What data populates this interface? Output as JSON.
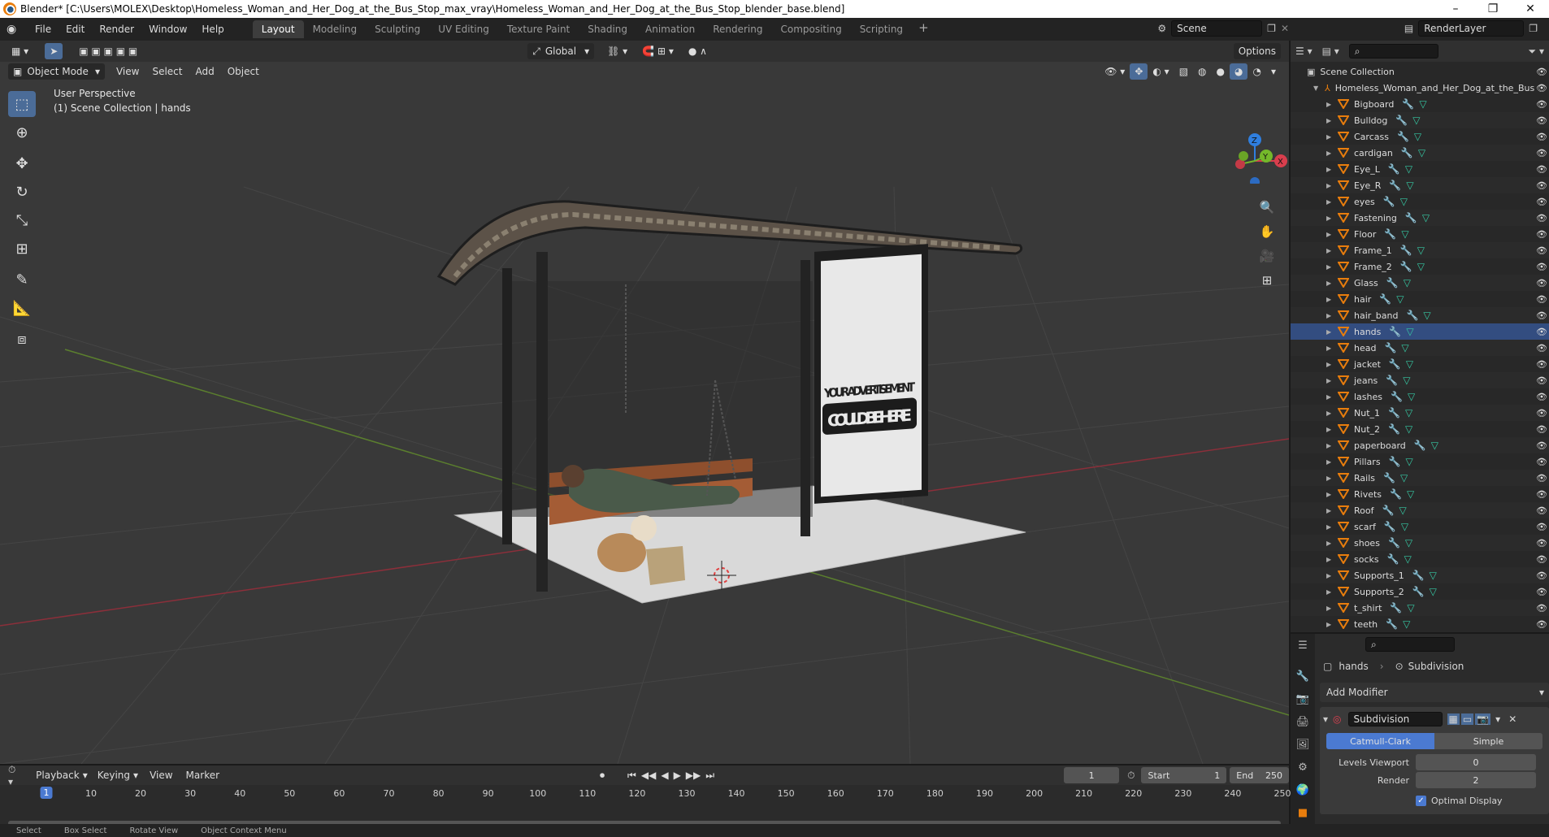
{
  "titlebar": {
    "title": "Blender* [C:\\Users\\MOLEX\\Desktop\\Homeless_Woman_and_Her_Dog_at_the_Bus_Stop_max_vray\\Homeless_Woman_and_Her_Dog_at_the_Bus_Stop_blender_base.blend]",
    "minimize": "–",
    "maximize": "❐",
    "close": "✕"
  },
  "menubar": {
    "items": [
      "File",
      "Edit",
      "Render",
      "Window",
      "Help"
    ],
    "workspaces": [
      "Layout",
      "Modeling",
      "Sculpting",
      "UV Editing",
      "Texture Paint",
      "Shading",
      "Animation",
      "Rendering",
      "Compositing",
      "Scripting"
    ],
    "active_workspace": "Layout",
    "add_tab": "+",
    "scene": "Scene",
    "render_layer": "RenderLayer"
  },
  "viewport": {
    "mode": "Object Mode",
    "menus": [
      "View",
      "Select",
      "Add",
      "Object"
    ],
    "orientation": "Global",
    "options": "Options",
    "perspective": "User Perspective",
    "collection_info": "(1) Scene Collection | hands",
    "billboard_line1": "YOUR ADVERTISEMENT",
    "billboard_line2": "COULD BE HERE",
    "gizmo": {
      "z": "Z",
      "y": "Y",
      "x": "X"
    }
  },
  "outliner": {
    "root": "Scene Collection",
    "collection": "Homeless_Woman_and_Her_Dog_at_the_Bus",
    "objects": [
      "Bigboard",
      "Bulldog",
      "Carcass",
      "cardigan",
      "Eye_L",
      "Eye_R",
      "eyes",
      "Fastening",
      "Floor",
      "Frame_1",
      "Frame_2",
      "Glass",
      "hair",
      "hair_band",
      "hands",
      "head",
      "jacket",
      "jeans",
      "lashes",
      "Nut_1",
      "Nut_2",
      "paperboard",
      "Pillars",
      "Rails",
      "Rivets",
      "Roof",
      "scarf",
      "shoes",
      "socks",
      "Supports_1",
      "Supports_2",
      "t_shirt",
      "teeth"
    ]
  },
  "properties": {
    "object": "hands",
    "modifier_tab": "Subdivision",
    "add_modifier": "Add Modifier",
    "modifier_name": "Subdivision",
    "catmull": "Catmull-Clark",
    "simple": "Simple",
    "levels_label": "Levels Viewport",
    "levels_value": "0",
    "render_label": "Render",
    "render_value": "2",
    "optimal_display": "Optimal Display"
  },
  "timeline": {
    "menus": [
      "Playback",
      "Keying",
      "View",
      "Marker"
    ],
    "current_frame": "1",
    "start_label": "Start",
    "start_value": "1",
    "end_label": "End",
    "end_value": "250",
    "ticks": [
      "10",
      "20",
      "30",
      "40",
      "50",
      "60",
      "70",
      "80",
      "90",
      "100",
      "110",
      "120",
      "130",
      "140",
      "150",
      "160",
      "170",
      "180",
      "190",
      "200",
      "210",
      "220",
      "230",
      "240",
      "250"
    ]
  },
  "statusbar": {
    "items": [
      "Select",
      "Box Select",
      "Rotate View",
      "Object Context Menu"
    ]
  }
}
